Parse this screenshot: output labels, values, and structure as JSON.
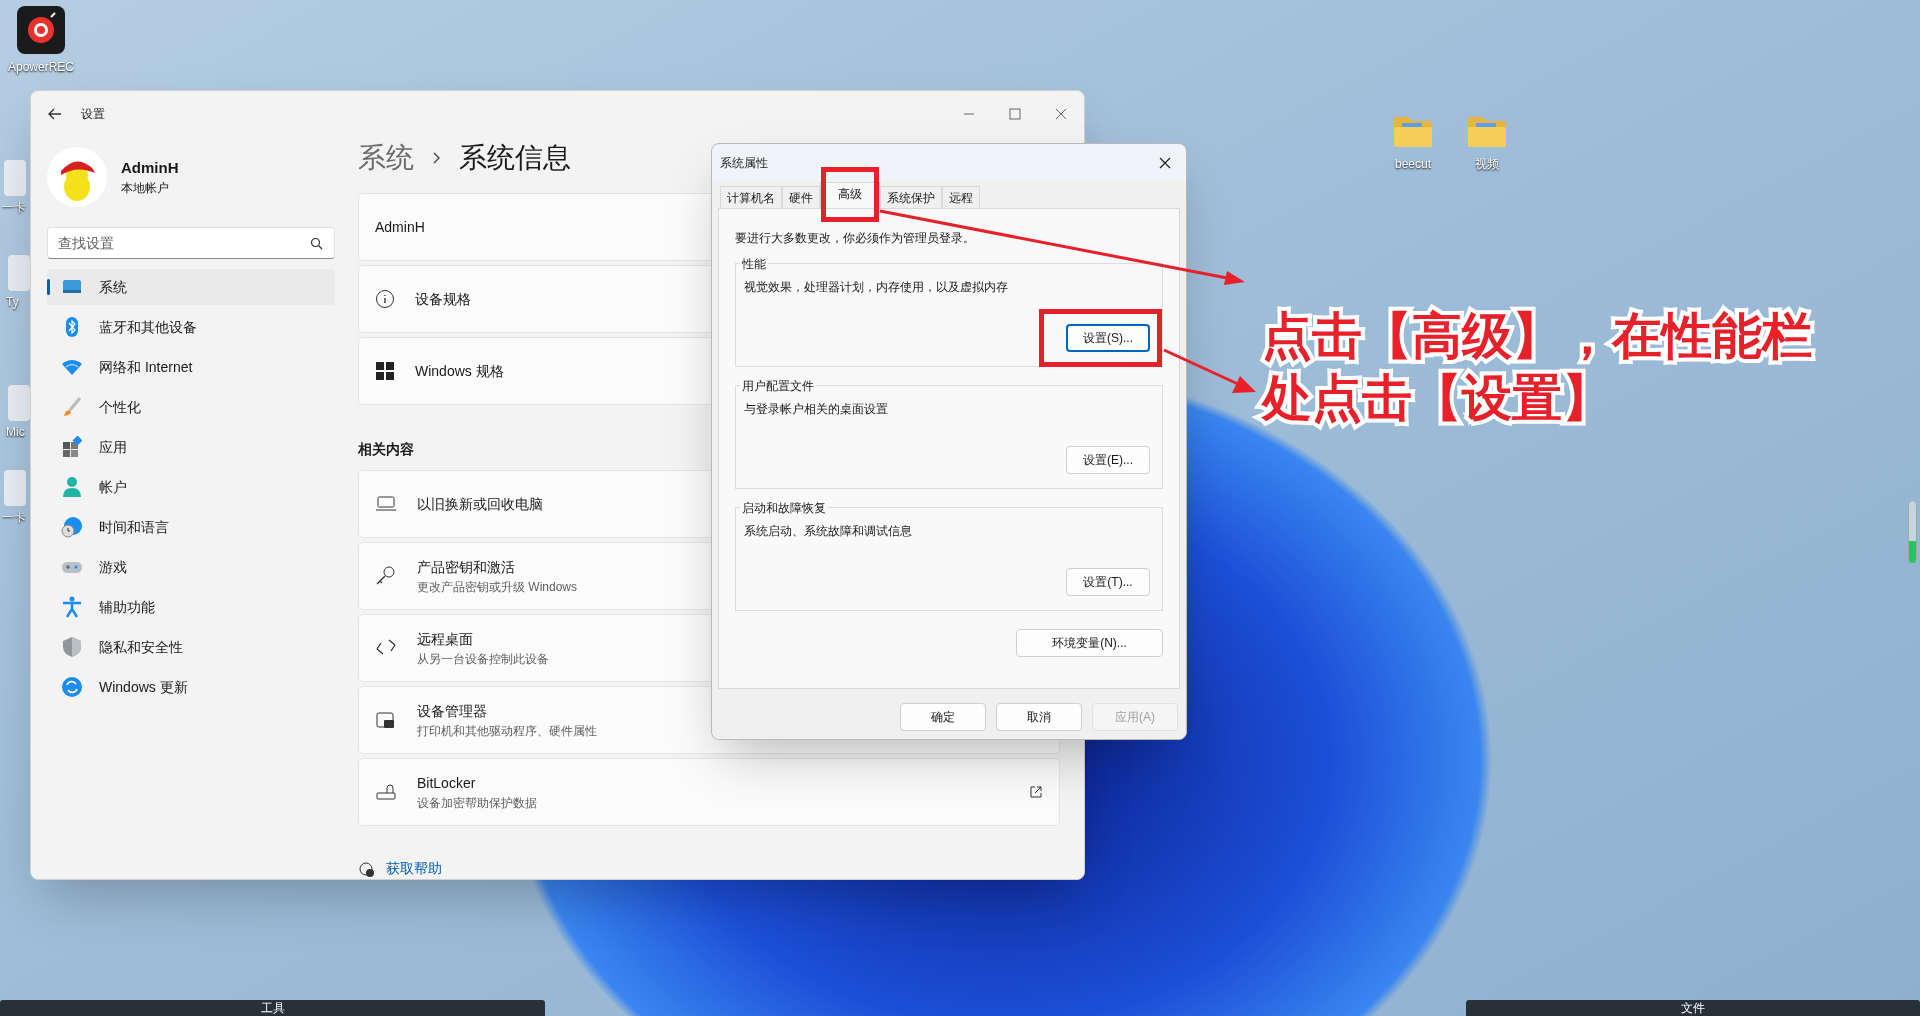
{
  "desktop_icons": [
    {
      "label": "ApowerREC",
      "kind": "app"
    },
    {
      "label": "一卡",
      "kind": "hidden"
    },
    {
      "label": "Ty",
      "kind": "hidden"
    },
    {
      "label": "Mic",
      "kind": "hidden"
    },
    {
      "label": "一卡",
      "kind": "hidden"
    },
    {
      "label": "beecut",
      "kind": "folder"
    },
    {
      "label": "视频",
      "kind": "folder"
    }
  ],
  "settings": {
    "title": "设置",
    "user": {
      "name": "AdminH",
      "account_type": "本地帐户"
    },
    "search": {
      "placeholder": "查找设置"
    },
    "nav": [
      {
        "label": "系统",
        "selected": true
      },
      {
        "label": "蓝牙和其他设备",
        "selected": false
      },
      {
        "label": "网络和 Internet",
        "selected": false
      },
      {
        "label": "个性化",
        "selected": false
      },
      {
        "label": "应用",
        "selected": false
      },
      {
        "label": "帐户",
        "selected": false
      },
      {
        "label": "时间和语言",
        "selected": false
      },
      {
        "label": "游戏",
        "selected": false
      },
      {
        "label": "辅助功能",
        "selected": false
      },
      {
        "label": "隐私和安全性",
        "selected": false
      },
      {
        "label": "Windows 更新",
        "selected": false
      }
    ],
    "breadcrumb": {
      "parent": "系统",
      "current": "系统信息"
    },
    "device_name": "AdminH",
    "cards": [
      {
        "title": "设备规格"
      },
      {
        "title": "Windows 规格"
      }
    ],
    "related_heading": "相关内容",
    "related": [
      {
        "title": "以旧换新或回收电脑"
      },
      {
        "title": "产品密钥和激活",
        "subtitle": "更改产品密钥或升级 Windows"
      },
      {
        "title": "远程桌面",
        "subtitle": "从另一台设备控制此设备"
      },
      {
        "title": "设备管理器",
        "subtitle": "打印机和其他驱动程序、硬件属性"
      },
      {
        "title": "BitLocker",
        "subtitle": "设备加密帮助保护数据",
        "external": true
      }
    ],
    "help_link": "获取帮助"
  },
  "dialog": {
    "title": "系统属性",
    "tabs": [
      {
        "label": "计算机名",
        "selected": false
      },
      {
        "label": "硬件",
        "selected": false
      },
      {
        "label": "高级",
        "selected": true
      },
      {
        "label": "系统保护",
        "selected": false
      },
      {
        "label": "远程",
        "selected": false
      }
    ],
    "admin_note": "要进行大多数更改，你必须作为管理员登录。",
    "groups": [
      {
        "title": "性能",
        "description": "视觉效果，处理器计划，内存使用，以及虚拟内存",
        "button": "设置(S)...",
        "focused": true
      },
      {
        "title": "用户配置文件",
        "description": "与登录帐户相关的桌面设置",
        "button": "设置(E)...",
        "focused": false
      },
      {
        "title": "启动和故障恢复",
        "description": "系统启动、系统故障和调试信息",
        "button": "设置(T)...",
        "focused": false
      }
    ],
    "env_button": "环境变量(N)...",
    "buttons": [
      {
        "label": "确定",
        "disabled": false
      },
      {
        "label": "取消",
        "disabled": false
      },
      {
        "label": "应用(A)",
        "disabled": true
      }
    ]
  },
  "annotation": {
    "text": "点击【高级】，在性能栏处点击【设置】"
  },
  "bottom_bars": [
    "工具",
    "文件"
  ]
}
